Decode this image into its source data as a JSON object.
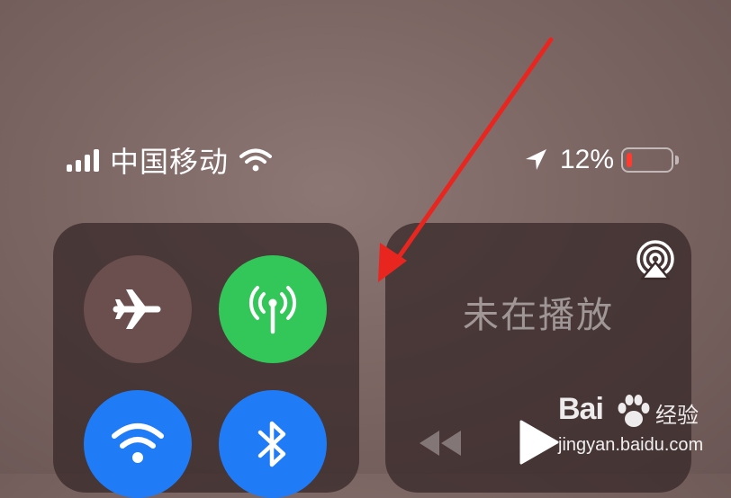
{
  "status_bar": {
    "carrier": "中国移动",
    "battery_percent": "12%",
    "battery_level": 0.12,
    "battery_color": "#ff3b30",
    "icons": [
      "signal-icon",
      "wifi-icon",
      "location-arrow-icon",
      "battery-icon"
    ]
  },
  "connectivity": {
    "airplane_mode": {
      "icon": "airplane-icon",
      "active": false
    },
    "cellular_data": {
      "icon": "cellular-antenna-icon",
      "active": true,
      "color": "#33c759"
    },
    "wifi": {
      "icon": "wifi-icon",
      "active": true,
      "color": "#1f7bf6"
    },
    "bluetooth": {
      "icon": "bluetooth-icon",
      "active": true,
      "color": "#1f7bf6"
    }
  },
  "now_playing": {
    "title": "未在播放",
    "icons": [
      "airplay-icon",
      "rewind-icon",
      "play-icon"
    ]
  },
  "watermark": {
    "brand": "Bai",
    "brand_cn": "经验",
    "url": "jingyan.baidu.com"
  },
  "annotation": {
    "arrow_color": "#e8261f"
  }
}
